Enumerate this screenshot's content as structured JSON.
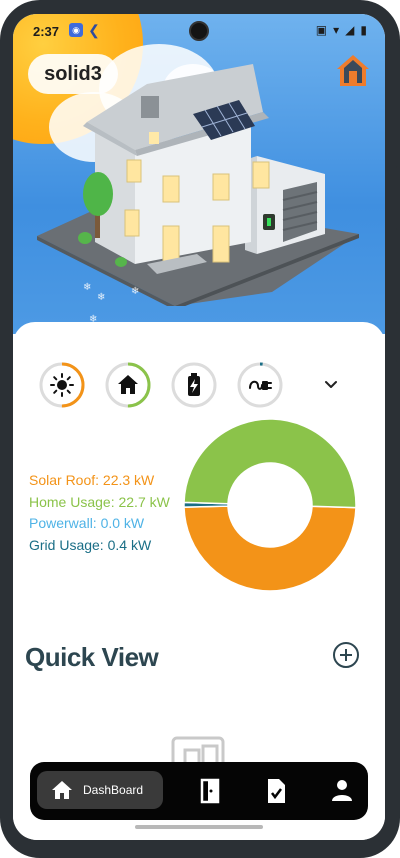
{
  "status_bar": {
    "time": "2:37",
    "icons": [
      "radio-icon",
      "charging-icon",
      "nfc-icon",
      "wifi-icon",
      "signal-icon",
      "battery-icon"
    ]
  },
  "header": {
    "brand": "solid3",
    "home_icon": "house-outline-icon"
  },
  "energy_rings": [
    {
      "name": "solar",
      "icon": "sun-icon",
      "color": "#f39318",
      "fill": 0.5
    },
    {
      "name": "home",
      "icon": "home-icon",
      "color": "#8bc34a",
      "fill": 0.5
    },
    {
      "name": "powerwall",
      "icon": "battery-bolt-icon",
      "color": "#4fb3e6",
      "fill": 0.0
    },
    {
      "name": "grid",
      "icon": "plug-icon",
      "color": "#1a6e86",
      "fill": 0.02
    }
  ],
  "legend": {
    "solar": {
      "text": "Solar Roof: 22.3 kW",
      "color": "#f39318"
    },
    "home": {
      "text": "Home Usage: 22.7 kW",
      "color": "#8bc34a"
    },
    "powerwall": {
      "text": "Powerwall: 0.0 kW",
      "color": "#4fb3e6"
    },
    "grid": {
      "text": "Grid Usage: 0.4 kW",
      "color": "#1a6e86"
    }
  },
  "donut_data": {
    "segments": [
      {
        "name": "Solar Roof",
        "value": 22.3,
        "color": "#f39318"
      },
      {
        "name": "Home Usage",
        "value": 22.7,
        "color": "#8bc34a"
      },
      {
        "name": "Powerwall",
        "value": 0.0,
        "color": "#4fb3e6"
      },
      {
        "name": "Grid Usage",
        "value": 0.4,
        "color": "#1a6e86"
      }
    ]
  },
  "quick_view": {
    "title": "Quick View"
  },
  "nav": {
    "dashboard_label": "DashBoard",
    "items": [
      "home-icon",
      "door-icon",
      "task-check-icon",
      "person-icon"
    ]
  }
}
